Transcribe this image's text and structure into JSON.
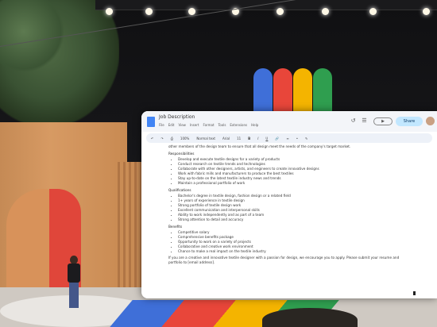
{
  "document": {
    "title": "Job Description",
    "menu": [
      "File",
      "Edit",
      "View",
      "Insert",
      "Format",
      "Tools",
      "Extensions",
      "Help"
    ],
    "share_label": "Share",
    "toolbar": [
      "100%",
      "Normal text",
      "Arial",
      "11"
    ],
    "intro": "other members of the design team to ensure that all design meet the needs of the company's target market.",
    "responsibilities_heading": "Responsibilities",
    "responsibilities": [
      "Develop and execute textile designs for a variety of products",
      "Conduct research on textile trends and technologies",
      "Collaborate with other designers, artists, and engineers to create innovative designs",
      "Work with fabric mills and manufacturers to produce the best textiles",
      "Stay up-to-date on the latest textile industry news and trends",
      "Maintain a professional portfolio of work"
    ],
    "qualifications_heading": "Qualifications",
    "qualifications": [
      "Bachelor's degree in textile design, fashion design or a related field",
      "1+ years of experience in textile design",
      "Strong portfolio of textile design work",
      "Excellent communication and interpersonal skills",
      "Ability to work independently and as part of a team",
      "Strong attention to detail and accuracy"
    ],
    "benefits_heading": "Benefits",
    "benefits": [
      "Competitive salary",
      "Comprehensive benefits package",
      "Opportunity to work on a variety of projects",
      "Collaborative and creative work environment",
      "Chance to make a real impact on the textile industry"
    ],
    "closing": "If you are a creative and innovative textile designer with a passion for design, we encourage you to apply. Please submit your resume and portfolio to [email address]."
  },
  "colors": {
    "blue": "#4285f4",
    "red": "#ea4335",
    "yellow": "#fbbc04",
    "green": "#34a853"
  }
}
